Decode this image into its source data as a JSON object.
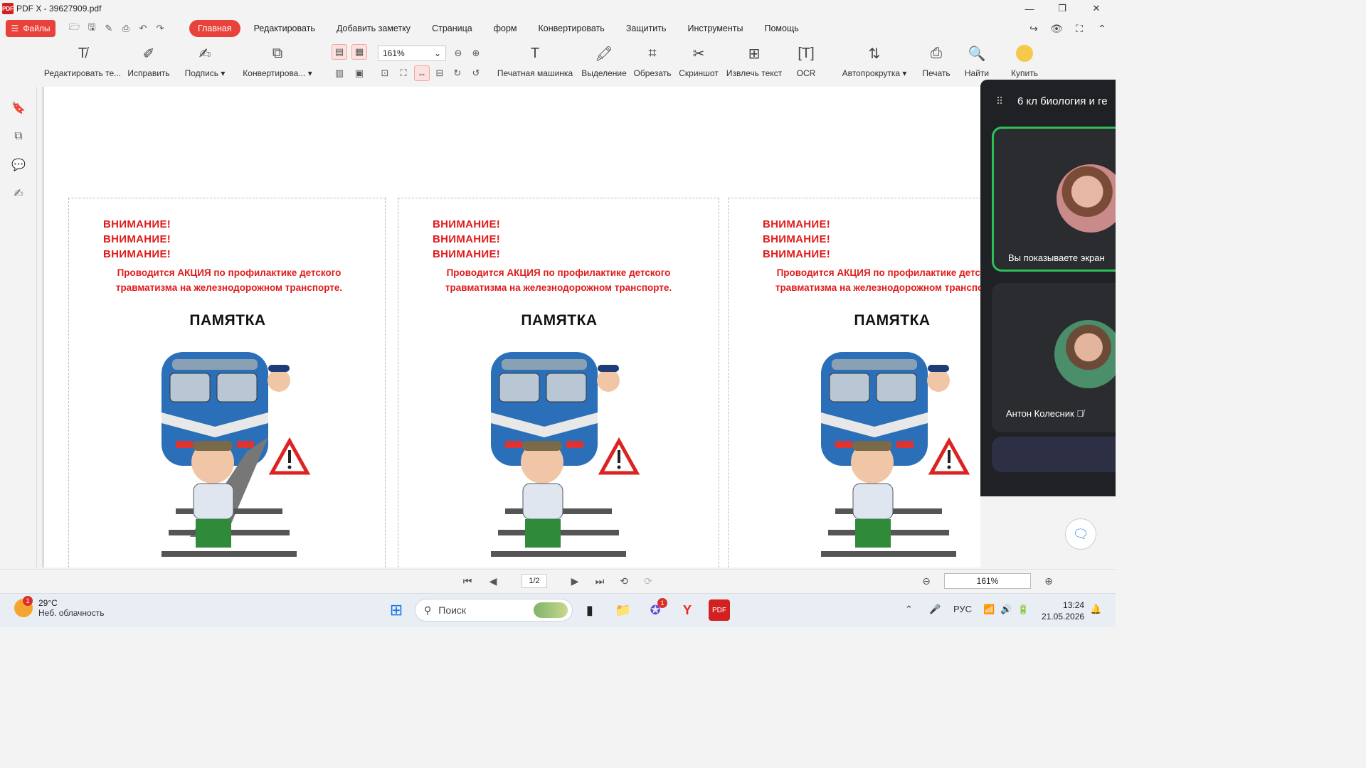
{
  "window": {
    "title": "PDF X - 39627909.pdf",
    "logo_text": "PDF"
  },
  "menu": {
    "files_label": "Файлы",
    "items": [
      "Главная",
      "Редактировать",
      "Добавить заметку",
      "Страница",
      "форм",
      "Конвертировать",
      "Защитить",
      "Инструменты",
      "Помощь"
    ]
  },
  "ribbon": {
    "tools": [
      {
        "label": "Редактировать те...",
        "icon": "edit-text-icon"
      },
      {
        "label": "Исправить",
        "icon": "fix-icon"
      },
      {
        "label": "Подпись ▾",
        "icon": "signature-icon"
      },
      {
        "label": "Конвертирова... ▾",
        "icon": "convert-icon"
      },
      {
        "label": "Печатная машинка",
        "icon": "typewriter-icon"
      },
      {
        "label": "Выделение",
        "icon": "highlight-icon"
      },
      {
        "label": "Обрезать",
        "icon": "crop-icon"
      },
      {
        "label": "Скриншот",
        "icon": "screenshot-icon"
      },
      {
        "label": "Извлечь текст",
        "icon": "extract-text-icon"
      },
      {
        "label": "OCR",
        "icon": "ocr-icon"
      },
      {
        "label": "Автопрокрутка ▾",
        "icon": "autoscroll-icon"
      },
      {
        "label": "Печать",
        "icon": "print-icon"
      },
      {
        "label": "Найти",
        "icon": "find-icon"
      },
      {
        "label": "Купить",
        "icon": "buy-icon"
      }
    ],
    "zoom": "161%"
  },
  "document": {
    "warning": "ВНИМАНИЕ!",
    "action_text": "Проводится АКЦИЯ по профилактике детского травматизма на железнодорожном транспорте.",
    "heading": "ПАМЯТКА"
  },
  "bottom": {
    "page_indicator": "1/2",
    "zoom": "161%"
  },
  "call": {
    "title": "6 кл биология и ге",
    "tile1_label": "Вы показываете экран",
    "tile2_label": "Антон Колесник"
  },
  "taskbar": {
    "temperature": "29°C",
    "weather": "Неб. облачность",
    "weather_badge": "1",
    "search_placeholder": "Поиск",
    "lang": "РУС",
    "time": "13:24",
    "date": "21.05.2026",
    "app_badge": "1"
  },
  "colors": {
    "accent": "#e8423a",
    "warning_text": "#e01b1b",
    "call_active": "#2fbf59"
  }
}
